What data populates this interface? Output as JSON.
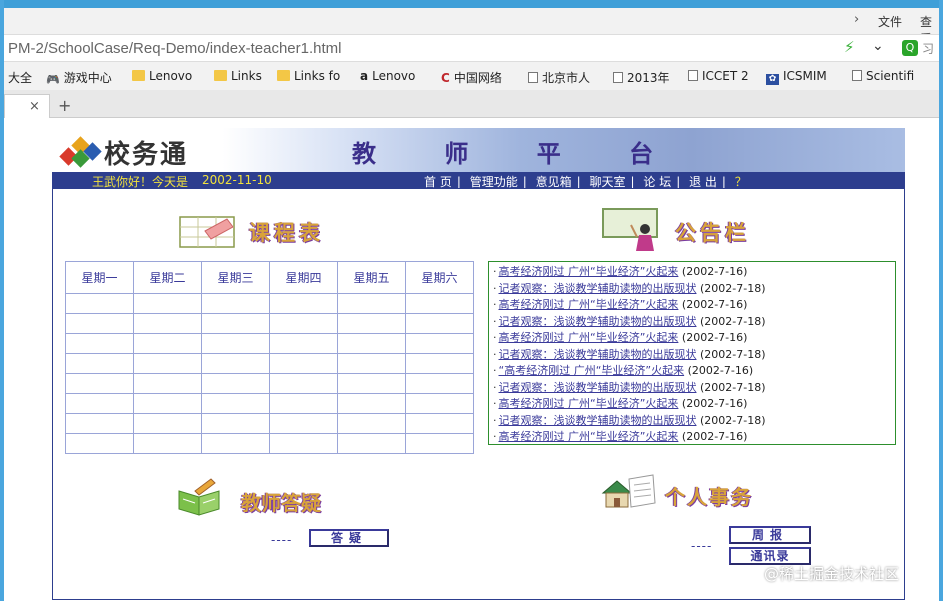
{
  "browser": {
    "menu": {
      "file_label": "文件",
      "view_label": "查看"
    },
    "address": {
      "url": "PM-2/SchoolCase/Req-Demo/index-teacher1.html",
      "search_text": "习"
    },
    "bookmarks": [
      {
        "label": "大全",
        "icon": "none"
      },
      {
        "label": "游戏中心",
        "icon": "gamepad-icon"
      },
      {
        "label": "Lenovo",
        "icon": "folder-icon"
      },
      {
        "label": "Links",
        "icon": "folder-icon"
      },
      {
        "label": "Links fo",
        "icon": "folder-icon"
      },
      {
        "label": "Lenovo",
        "icon": "amazon-icon"
      },
      {
        "label": "中国网络",
        "icon": "red-c-icon"
      },
      {
        "label": "北京市人",
        "icon": "page-icon"
      },
      {
        "label": "2013年",
        "icon": "page-icon"
      },
      {
        "label": "ICCET 2",
        "icon": "page-icon"
      },
      {
        "label": "ICSMIM",
        "icon": "paw-icon"
      },
      {
        "label": "Scientifi",
        "icon": "page-icon"
      }
    ],
    "tab": {
      "close_label": "×",
      "new_tab_label": "+"
    }
  },
  "site": {
    "logo_text": "校务通",
    "platform_title": "教 师 平 台",
    "greeting": "王武你好！今天是",
    "date": "2002-11-10",
    "nav": [
      "首 页",
      "管理功能",
      "意见箱",
      "聊天室",
      "论 坛",
      "退 出",
      "？"
    ]
  },
  "schedule": {
    "title": "课程表",
    "days": [
      "星期一",
      "星期二",
      "星期三",
      "星期四",
      "星期五",
      "星期六"
    ],
    "row_count": 8
  },
  "notices": {
    "title": "公告栏",
    "items": [
      {
        "text": "高考经济刚过 广州“毕业经济”火起来",
        "date": "(2002-7-16)"
      },
      {
        "text": "记者观察：浅谈教学辅助读物的出版现状",
        "date": "(2002-7-18)"
      },
      {
        "text": "高考经济刚过 广州“毕业经济”火起来",
        "date": "(2002-7-16)"
      },
      {
        "text": "记者观察：浅谈教学辅助读物的出版现状",
        "date": "(2002-7-18)"
      },
      {
        "text": "高考经济刚过 广州“毕业经济”火起来",
        "date": "(2002-7-16)"
      },
      {
        "text": "记者观察：浅谈教学辅助读物的出版现状",
        "date": "(2002-7-18)"
      },
      {
        "text": "“高考经济刚过 广州“毕业经济”火起来",
        "date": "(2002-7-16)"
      },
      {
        "text": "记者观察：浅谈教学辅助读物的出版现状",
        "date": "(2002-7-18)"
      },
      {
        "text": "高考经济刚过 广州“毕业经济”火起来",
        "date": "(2002-7-16)"
      },
      {
        "text": "记者观察：浅谈教学辅助读物的出版现状",
        "date": "(2002-7-18)"
      },
      {
        "text": "高考经济刚过 广州“毕业经济”火起来",
        "date": "(2002-7-16)"
      }
    ]
  },
  "qa": {
    "title": "教师答疑",
    "dashes": "----",
    "button_label": "答疑"
  },
  "personal": {
    "title": "个人事务",
    "dashes": "----",
    "weekly_label": "周报",
    "contacts_label": "通讯录"
  },
  "watermark": "@稀土掘金技术社区",
  "colors": {
    "nav_bg": "#2d3e8e",
    "link": "#3a3a9a",
    "title_gold": "#d8a33a",
    "frame_blue": "#3f9fd8"
  }
}
